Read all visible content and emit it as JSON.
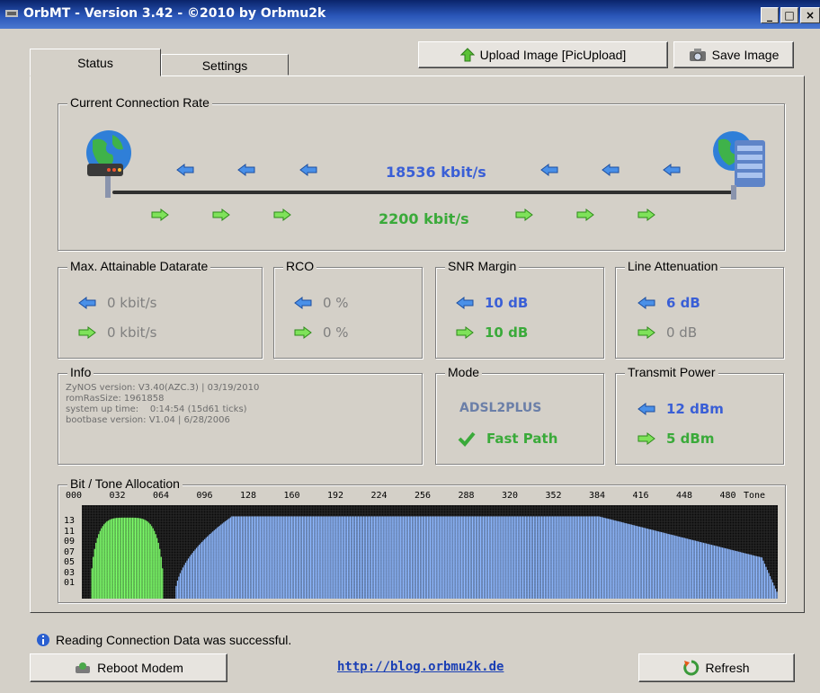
{
  "window": {
    "title": "OrbMT - Version 3.42 - ©2010 by Orbmu2k"
  },
  "caption_buttons": {
    "minimize": "_",
    "maximize": "□",
    "close": "×"
  },
  "tabs": [
    {
      "label": "Status"
    },
    {
      "label": "Settings"
    }
  ],
  "toolbar": {
    "upload_label": "Upload Image [PicUpload]",
    "save_label": "Save Image"
  },
  "connection": {
    "legend": "Current Connection Rate",
    "downstream": "18536 kbit/s",
    "upstream": "2200 kbit/s"
  },
  "max_rate": {
    "legend": "Max. Attainable Datarate",
    "down": "0 kbit/s",
    "up": "0 kbit/s"
  },
  "rco": {
    "legend": "RCO",
    "down": "0 %",
    "up": "0 %"
  },
  "snr": {
    "legend": "SNR Margin",
    "down": "10 dB",
    "up": "10 dB"
  },
  "attenuation": {
    "legend": "Line Attenuation",
    "down": "6 dB",
    "up": "0 dB"
  },
  "info": {
    "legend": "Info",
    "lines": [
      "ZyNOS version: V3.40(AZC.3) | 03/19/2010",
      "romRasSize: 1961858",
      "system up time:    0:14:54 (15d61 ticks)",
      "bootbase version: V1.04 | 6/28/2006"
    ]
  },
  "mode": {
    "legend": "Mode",
    "value": "ADSL2PLUS",
    "path": "Fast Path"
  },
  "transmit_power": {
    "legend": "Transmit Power",
    "down": "12 dBm",
    "up": "5 dBm"
  },
  "bittone": {
    "legend": "Bit / Tone Allocation",
    "x_ticks": [
      "000",
      "032",
      "064",
      "096",
      "128",
      "160",
      "192",
      "224",
      "256",
      "288",
      "320",
      "352",
      "384",
      "416",
      "448",
      "480"
    ],
    "x_unit": "Tone",
    "y_ticks": [
      "13",
      "11",
      "09",
      "07",
      "05",
      "03",
      "01"
    ]
  },
  "status": {
    "message": "Reading Connection Data was successful."
  },
  "footer": {
    "reboot_label": "Reboot Modem",
    "link": "http://blog.orbmu2k.de",
    "refresh_label": "Refresh"
  },
  "colors": {
    "downstream": "#3a5fd6",
    "upstream": "#3aaa3a",
    "titlebar": "#0a246a"
  },
  "icons": [
    "arrow-left-icon",
    "arrow-right-icon",
    "modem-globe-icon",
    "server-globe-icon",
    "checkmark-icon",
    "info-icon",
    "upload-icon",
    "camera-icon",
    "reboot-icon",
    "refresh-icon"
  ]
}
